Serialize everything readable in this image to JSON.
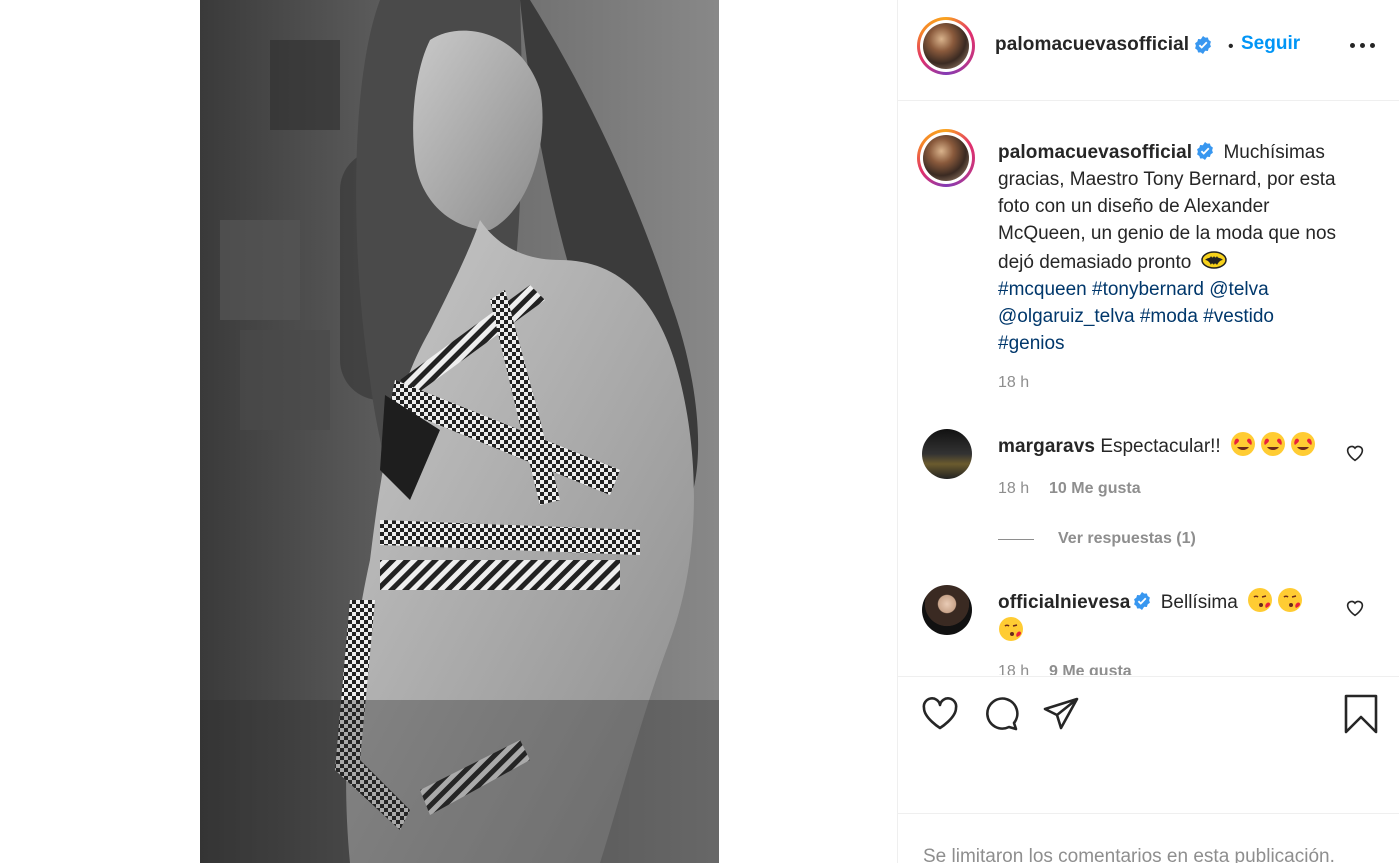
{
  "post": {
    "username": "palomacuevasofficial",
    "dot": "•",
    "follow_label": "Seguir",
    "verified": true
  },
  "caption": {
    "username": "palomacuevasofficial",
    "text": "Muchísimas gracias, Maestro Tony Bernard, por esta foto con un diseño de Alexander McQueen, un genio de la moda que nos dejó demasiado pronto",
    "emoji": "bat-emoji",
    "tags": [
      "#mcqueen",
      "#tonybernard",
      "@telva",
      "@olgaruiz_telva",
      "#moda",
      "#vestido",
      "#genios"
    ],
    "time": "18 h"
  },
  "comments": [
    {
      "username": "margaravs",
      "text": "Espectacular!!",
      "emoji": "heart-eyes-emoji x3",
      "time": "18 h",
      "likes": "10 Me gusta",
      "replies": "Ver respuestas (1)"
    },
    {
      "username": "officialnievesa",
      "text": "Bellísima",
      "emoji": "kiss-emoji x3",
      "time": "18 h",
      "likes": "9 Me gusta",
      "verified": true
    }
  ],
  "footer": {
    "notice": "Se limitaron los comentarios en esta publicación."
  },
  "icons": [
    "verified-badge-icon",
    "more-options-icon",
    "heart-icon",
    "comment-icon",
    "share-icon",
    "bookmark-icon"
  ],
  "colors": {
    "follow_blue": "#0095f6",
    "tag_blue": "#00376b",
    "verified_blue": "#3897f0",
    "muted": "#8e8e8e"
  }
}
